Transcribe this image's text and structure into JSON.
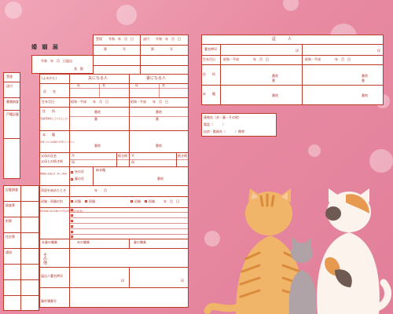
{
  "form": {
    "title": "婚 姻 届",
    "submitted_date": "令和　年　月　日届出",
    "addressee": "長　殿",
    "received_label": "受理",
    "sent_label": "送付",
    "reiwa": "令和",
    "nen_tsuki_hi": "年　月　日",
    "number_label": "第　　　　　号",
    "husband_header": "夫になる人",
    "wife_header": "妻になる人",
    "furigana": "(よみかた)",
    "name_label": "氏　　名",
    "shi": "氏",
    "mei": "名",
    "birth_label": "生年月日",
    "birth_era": "昭和・平成",
    "address_label": "住　　所",
    "address_note": "(住民登録をしているところ)",
    "banchi": "番地",
    "ban": "番",
    "go": "号",
    "honseki_label": "本　　籍",
    "honseki_note": "(外国人のときは国籍だけを書いてください)",
    "parents_label": "父母の氏名",
    "parents_note": "父母との続き柄",
    "father": "父",
    "mother": "母",
    "zokugara": "続き柄",
    "after_marriage_label": "婚姻後の夫婦の氏・新しい本籍",
    "husband_surname": "夫の氏",
    "wife_surname": "妻の氏",
    "new_honseki": "新本籍",
    "cohabit_label": "同居を始めたとき",
    "cohabit_value": "年　　月",
    "prior_marriage_label": "初婚・再婚の別",
    "shokon": "初婚",
    "saikon": "再婚",
    "cohabit_before_label": "同居を始める前の夫婦のそれぞれの世帯のおもな仕事と",
    "occupation_label": "夫妻の職業",
    "husband_job": "夫の職業",
    "wife_job": "妻の職業",
    "other_label": "その他",
    "signature_label": "届出人署名押印",
    "seal": "印",
    "register_label": "事件簿番号",
    "left_margin": [
      "受理",
      "送付",
      "書類調査",
      "戸籍記載",
      "記載調査",
      "調査票",
      "附票",
      "住民票",
      "通知"
    ]
  },
  "witness": {
    "title": "証　　　人",
    "name_label": "署名押印",
    "seal": "印",
    "birth_label": "生年月日",
    "birth_era": "昭和・平成",
    "nen_tsuki_hi": "年　月　日",
    "address_label": "住　　所",
    "honseki_label": "本　　籍",
    "banchi": "番地",
    "ban": "番",
    "go": "号"
  },
  "contact": {
    "title": "連絡先（夫・妻・その他）",
    "phone_label": "電話（　　　）",
    "home_label": "自宅・勤務先（　　　）携帯"
  },
  "colors": {
    "background": "#e88aa2",
    "ink": "#c03a2b",
    "paper": "#ffffff"
  }
}
